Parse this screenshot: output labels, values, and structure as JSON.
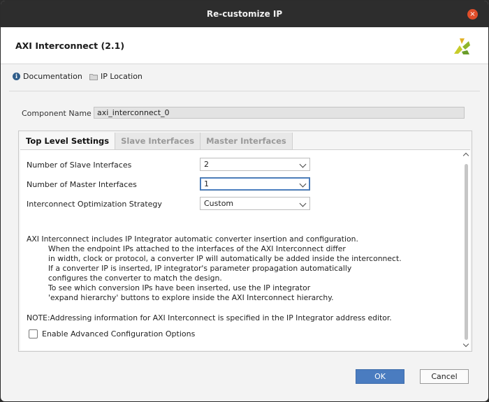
{
  "window": {
    "title": "Re-customize IP",
    "close_icon": "×"
  },
  "header": {
    "ip_title": "AXI Interconnect (2.1)",
    "logo_icon": "xilinx-logo"
  },
  "links": {
    "documentation": "Documentation",
    "ip_location": "IP Location"
  },
  "component": {
    "label": "Component Name",
    "value": "axi_interconnect_0"
  },
  "tabs": [
    {
      "label": "Top Level Settings",
      "active": true
    },
    {
      "label": "Slave Interfaces",
      "active": false
    },
    {
      "label": "Master Interfaces",
      "active": false
    }
  ],
  "settings": {
    "slave_count": {
      "label": "Number of Slave Interfaces",
      "value": "2"
    },
    "master_count": {
      "label": "Number of Master Interfaces",
      "value": "1"
    },
    "strategy": {
      "label": "Interconnect Optimization Strategy",
      "value": "Custom"
    }
  },
  "description": {
    "line1": "AXI Interconnect includes IP Integrator automatic converter insertion and configuration.",
    "line2": "When the endpoint IPs attached to the interfaces of the AXI Interconnect differ",
    "line3": "in width, clock or protocol, a converter IP will automatically be added inside the interconnect.",
    "line4": "If a converter IP is inserted, IP integrator's parameter propagation automatically",
    "line5": "configures the converter to match the design.",
    "line6": "To see which conversion IPs have been inserted, use the IP integrator",
    "line7": "'expand hierarchy' buttons to explore inside the AXI Interconnect hierarchy."
  },
  "note": "NOTE:Addressing information for AXI Interconnect is specified in the IP Integrator address editor.",
  "advanced": {
    "label": "Enable Advanced Configuration Options",
    "checked": false
  },
  "buttons": {
    "ok": "OK",
    "cancel": "Cancel"
  },
  "colors": {
    "accent": "#4a7cc0",
    "titlebar": "#2d2d2d",
    "close": "#e04e2a"
  }
}
